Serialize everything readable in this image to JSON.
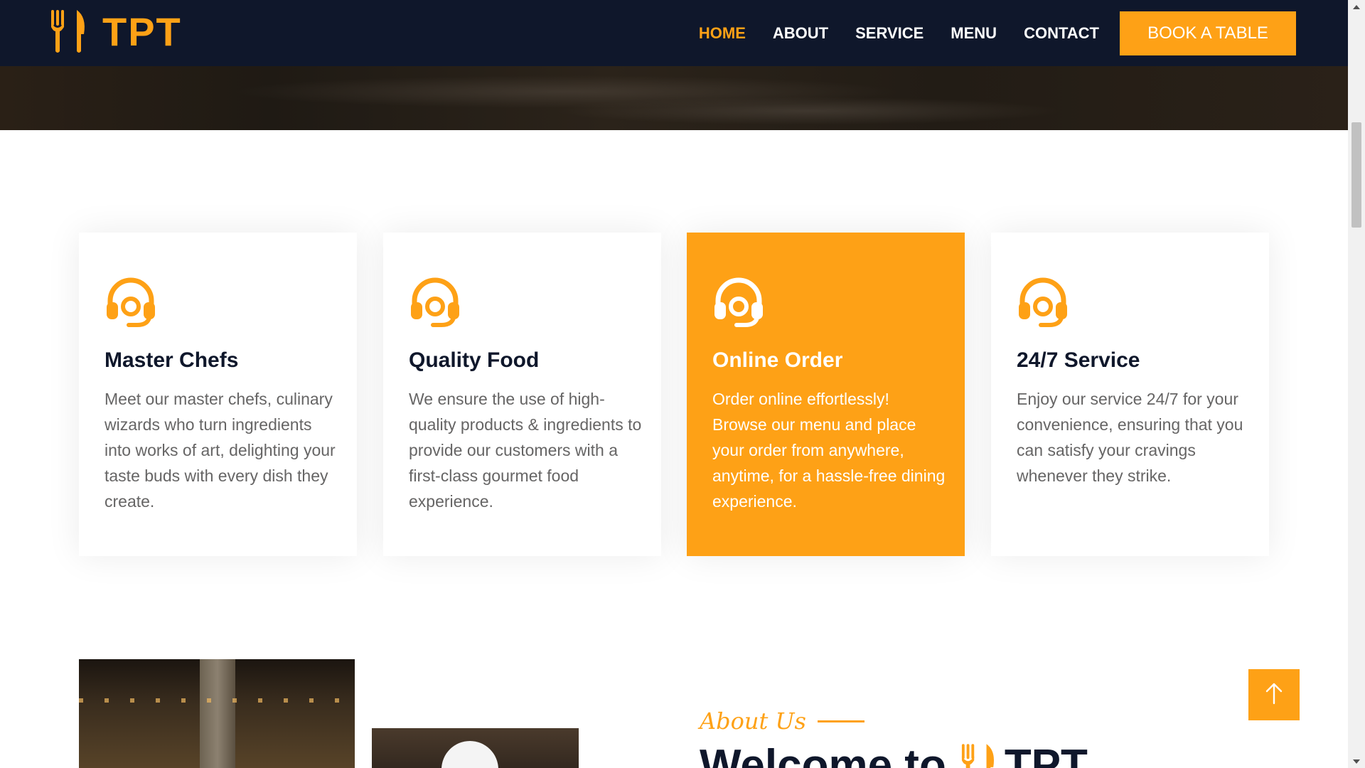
{
  "brand": {
    "name": "TPT",
    "icon": "utensils-icon"
  },
  "nav": {
    "items": [
      {
        "label": "HOME",
        "active": true
      },
      {
        "label": "ABOUT",
        "active": false
      },
      {
        "label": "SERVICE",
        "active": false
      },
      {
        "label": "MENU",
        "active": false
      },
      {
        "label": "CONTACT",
        "active": false
      }
    ],
    "cta": "BOOK A TABLE"
  },
  "services": [
    {
      "icon": "headset-icon",
      "title": "Master Chefs",
      "description": "Meet our master chefs, culinary wizards who turn ingredients into works of art, delighting your taste buds with every dish they create.",
      "highlighted": false
    },
    {
      "icon": "headset-icon",
      "title": "Quality Food",
      "description": "We ensure the use of high-quality products & ingredients to provide our customers with a first-class gourmet food experience.",
      "highlighted": false
    },
    {
      "icon": "headset-icon",
      "title": "Online Order",
      "description": "Order online effortlessly! Browse our menu and place your order from anywhere, anytime, for a hassle-free dining experience.",
      "highlighted": true
    },
    {
      "icon": "headset-icon",
      "title": "24/7 Service",
      "description": "Enjoy our service 24/7 for your convenience, ensuring that you can satisfy your cravings whenever they strike.",
      "highlighted": false
    }
  ],
  "about": {
    "subtitle": "About Us",
    "heading_prefix": "Welcome to",
    "heading_brand": "TPT"
  },
  "back_to_top": {
    "icon": "arrow-up-icon"
  },
  "colors": {
    "primary": "#fea116",
    "dark": "#0f172b",
    "text": "#666565"
  }
}
